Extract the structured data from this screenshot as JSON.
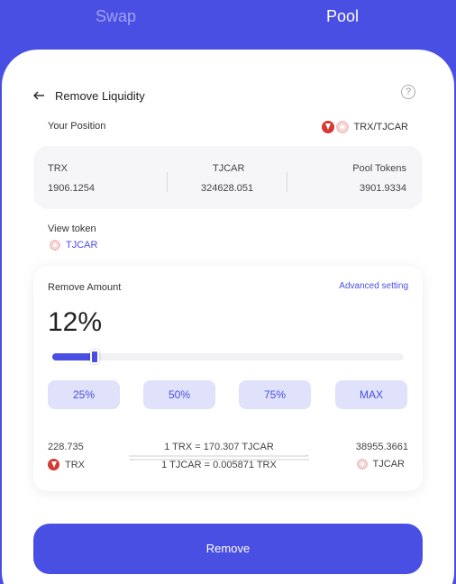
{
  "tabs": {
    "swap": "Swap",
    "pool": "Pool"
  },
  "header": {
    "title": "Remove Liquidity",
    "help_icon": "question-circle-icon",
    "help_glyph": "?"
  },
  "position": {
    "label": "Your Position",
    "pair": "TRX/TJCAR",
    "stats": [
      {
        "label": "TRX",
        "value": "1906.1254"
      },
      {
        "label": "TJCAR",
        "value": "324628.051"
      },
      {
        "label": "Pool Tokens",
        "value": "3901.9334"
      }
    ]
  },
  "view_token": {
    "label": "View token",
    "token": "TJCAR"
  },
  "remove_amount": {
    "label": "Remove Amount",
    "advanced": "Advanced setting",
    "percent_text": "12%",
    "percent_value": 12,
    "buttons": [
      "25%",
      "50%",
      "75%",
      "MAX"
    ]
  },
  "output": {
    "left": {
      "amount": "228.735",
      "token": "TRX"
    },
    "right": {
      "amount": "38955.3661",
      "token": "TJCAR"
    },
    "rate_top": "1 TRX = 170.307 TJCAR",
    "rate_bottom": "1 TJCAR = 0.005871 TRX"
  },
  "action": {
    "remove": "Remove"
  },
  "colors": {
    "accent": "#4a4fe3",
    "button_light": "#e0e1fb",
    "trx_red": "#d23a33"
  }
}
